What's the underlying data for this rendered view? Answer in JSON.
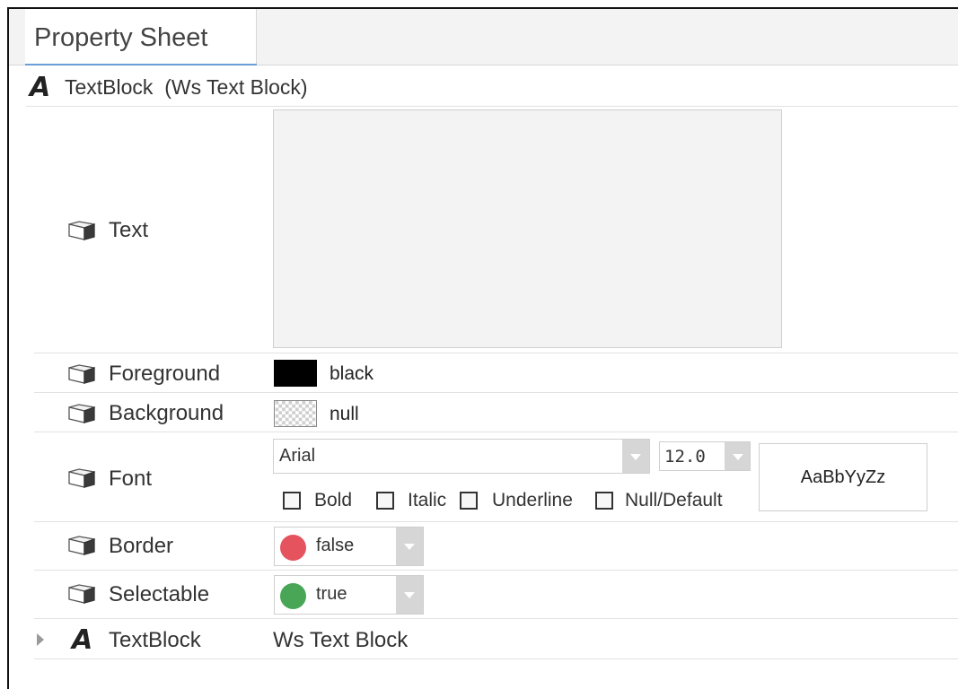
{
  "tab": {
    "label": "Property Sheet"
  },
  "header": {
    "name": "TextBlock",
    "type": "(Ws Text Block)"
  },
  "properties": {
    "text": {
      "label": "Text",
      "value": ""
    },
    "foreground": {
      "label": "Foreground",
      "value": "black",
      "color": "#000000"
    },
    "background": {
      "label": "Background",
      "value": "null"
    },
    "font": {
      "label": "Font",
      "family": "Arial",
      "size": "12.0",
      "preview": "AaBbYyZz",
      "options": {
        "bold": "Bold",
        "italic": "Italic",
        "underline": "Underline",
        "null_default": "Null/Default"
      }
    },
    "border": {
      "label": "Border",
      "value": "false",
      "color": "#e4535e"
    },
    "selectable": {
      "label": "Selectable",
      "value": "true",
      "color": "#49a656"
    }
  },
  "child": {
    "name": "TextBlock",
    "type": "Ws Text Block"
  }
}
